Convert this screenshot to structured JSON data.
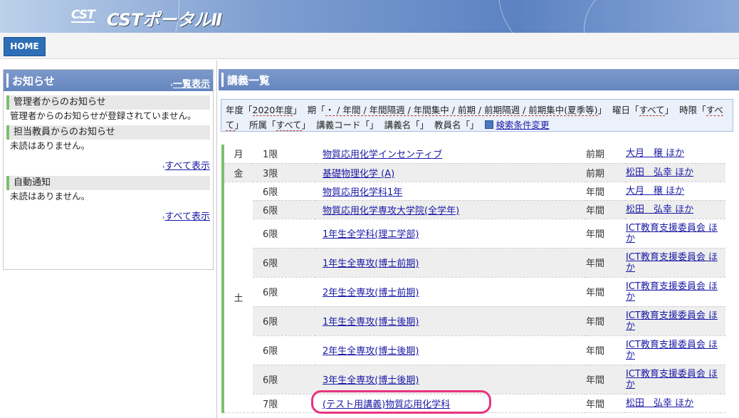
{
  "app": {
    "logo_mark": "CST",
    "logo_title": "CSTポータルⅡ"
  },
  "nav": {
    "home_label": "HOME"
  },
  "notices": {
    "title": "お知らせ",
    "view_all_label": "一覧表示",
    "sections": [
      {
        "heading": "管理者からのお知らせ",
        "body": "管理者からのお知らせが登録されていません。"
      },
      {
        "heading": "担当教員からのお知らせ",
        "body": "未読はありません。",
        "link": "すべて表示"
      },
      {
        "heading": "自動通知",
        "body": "未読はありません。",
        "link": "すべて表示"
      }
    ]
  },
  "lectures": {
    "title": "講義一覧",
    "conditions": {
      "year_prefix": "年度「",
      "year": "2020年度",
      "year_suffix": "」",
      "term_prefix": "期「",
      "term": "・ / 年間 / 年間隔週 / 年間集中 / 前期 / 前期隔週 / 前期集中(夏季等)",
      "term_suffix": "」",
      "day_prefix": "曜日「",
      "day": "すべて",
      "day_suffix": "」",
      "period_prefix": "時限「",
      "period": "すべて",
      "period_suffix": "」",
      "dept_prefix": "所属「",
      "dept": "すべて",
      "dept_suffix": "」",
      "code": "講義コード「」",
      "name": "講義名「」",
      "teacher": "教員名「」",
      "change_label": "検索条件変更"
    },
    "rows": [
      {
        "day": "月",
        "period": "1限",
        "course": "物質応用化学インセンティブ",
        "term": "前期",
        "instructor": "大月　穣 ほか"
      },
      {
        "day": "金",
        "period": "3限",
        "course": "基礎物理化学 (A)",
        "term": "前期",
        "instructor": "松田　弘幸 ほか"
      },
      {
        "day": "土",
        "period": "6限",
        "course": "物質応用化学科1年",
        "term": "年間",
        "instructor": "大月　穣 ほか"
      },
      {
        "day": "",
        "period": "6限",
        "course": "物質応用化学専攻大学院(全学年)",
        "term": "年間",
        "instructor": "松田　弘幸 ほか"
      },
      {
        "day": "",
        "period": "6限",
        "course": "1年生全学科(理工学部)",
        "term": "年間",
        "instructor": "ICT教育支援委員会 ほか"
      },
      {
        "day": "",
        "period": "6限",
        "course": "1年生全専攻(博士前期)",
        "term": "年間",
        "instructor": "ICT教育支援委員会 ほか"
      },
      {
        "day": "",
        "period": "6限",
        "course": "2年生全専攻(博士前期)",
        "term": "年間",
        "instructor": "ICT教育支援委員会 ほか"
      },
      {
        "day": "",
        "period": "6限",
        "course": "1年生全専攻(博士後期)",
        "term": "年間",
        "instructor": "ICT教育支援委員会 ほか"
      },
      {
        "day": "",
        "period": "6限",
        "course": "2年生全専攻(博士後期)",
        "term": "年間",
        "instructor": "ICT教育支援委員会 ほか"
      },
      {
        "day": "",
        "period": "6限",
        "course": "3年生全専攻(博士後期)",
        "term": "年間",
        "instructor": "ICT教育支援委員会 ほか"
      },
      {
        "day": "",
        "period": "7限",
        "course": "(テスト用講義)物質応用化学科",
        "term": "年間",
        "instructor": "松田　弘幸 ほか"
      }
    ]
  },
  "colors": {
    "accent_green": "#7ac16c",
    "panel_blue": "#6486bf",
    "highlight_pink": "#e8337e"
  }
}
